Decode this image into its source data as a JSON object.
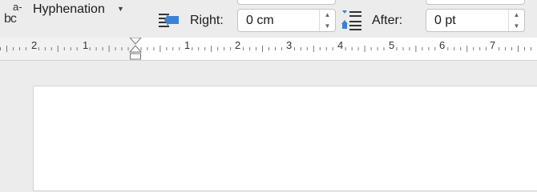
{
  "toolbar": {
    "hyphenation": {
      "label": "Hyphenation",
      "icon": "hyphenation-icon"
    },
    "indent_right": {
      "label": "Right:",
      "value": "0 cm",
      "icon": "indent-right-icon"
    },
    "spacing_after": {
      "label": "After:",
      "value": "0 pt",
      "icon": "paragraph-spacing-icon"
    }
  },
  "ruler": {
    "labels": [
      "2",
      "1",
      "1",
      "2",
      "3",
      "4",
      "5",
      "6",
      "7"
    ]
  },
  "colors": {
    "accent_blue": "#3b82d6",
    "ruler_bg": "#ffffff",
    "toolbar_bg": "#ececec"
  }
}
